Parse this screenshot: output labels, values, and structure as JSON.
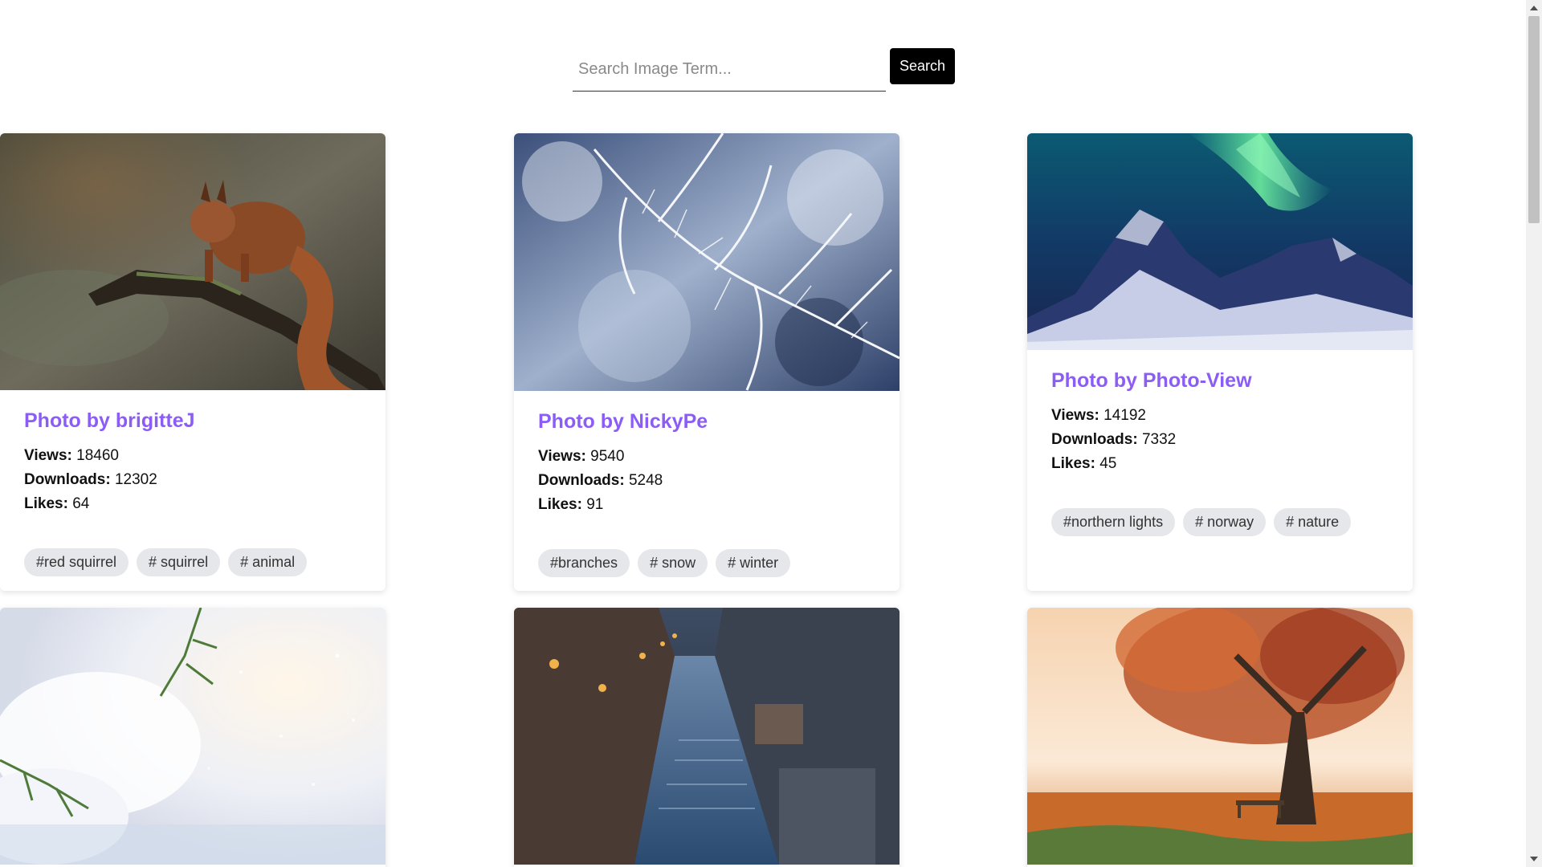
{
  "search": {
    "placeholder": "Search Image Term...",
    "value": "",
    "button_label": "Search"
  },
  "labels": {
    "views": "Views:",
    "downloads": "Downloads:",
    "likes": "Likes:"
  },
  "cards": [
    {
      "title": "Photo by brigitteJ",
      "views": "18460",
      "downloads": "12302",
      "likes": "64",
      "tags": [
        "#red squirrel",
        "# squirrel",
        "# animal"
      ]
    },
    {
      "title": "Photo by NickyPe",
      "views": "9540",
      "downloads": "5248",
      "likes": "91",
      "tags": [
        "#branches",
        "# snow",
        "# winter"
      ]
    },
    {
      "title": "Photo by Photo-View",
      "views": "14192",
      "downloads": "7332",
      "likes": "45",
      "tags": [
        "#northern lights",
        "# norway",
        "# nature"
      ]
    }
  ],
  "colors": {
    "title_accent": "#8b5cf6",
    "tag_bg": "#e5e7eb",
    "button_bg": "#000000"
  },
  "icons": {
    "scroll_up": "scroll-up-arrow-icon",
    "scroll_down": "scroll-down-arrow-icon"
  }
}
